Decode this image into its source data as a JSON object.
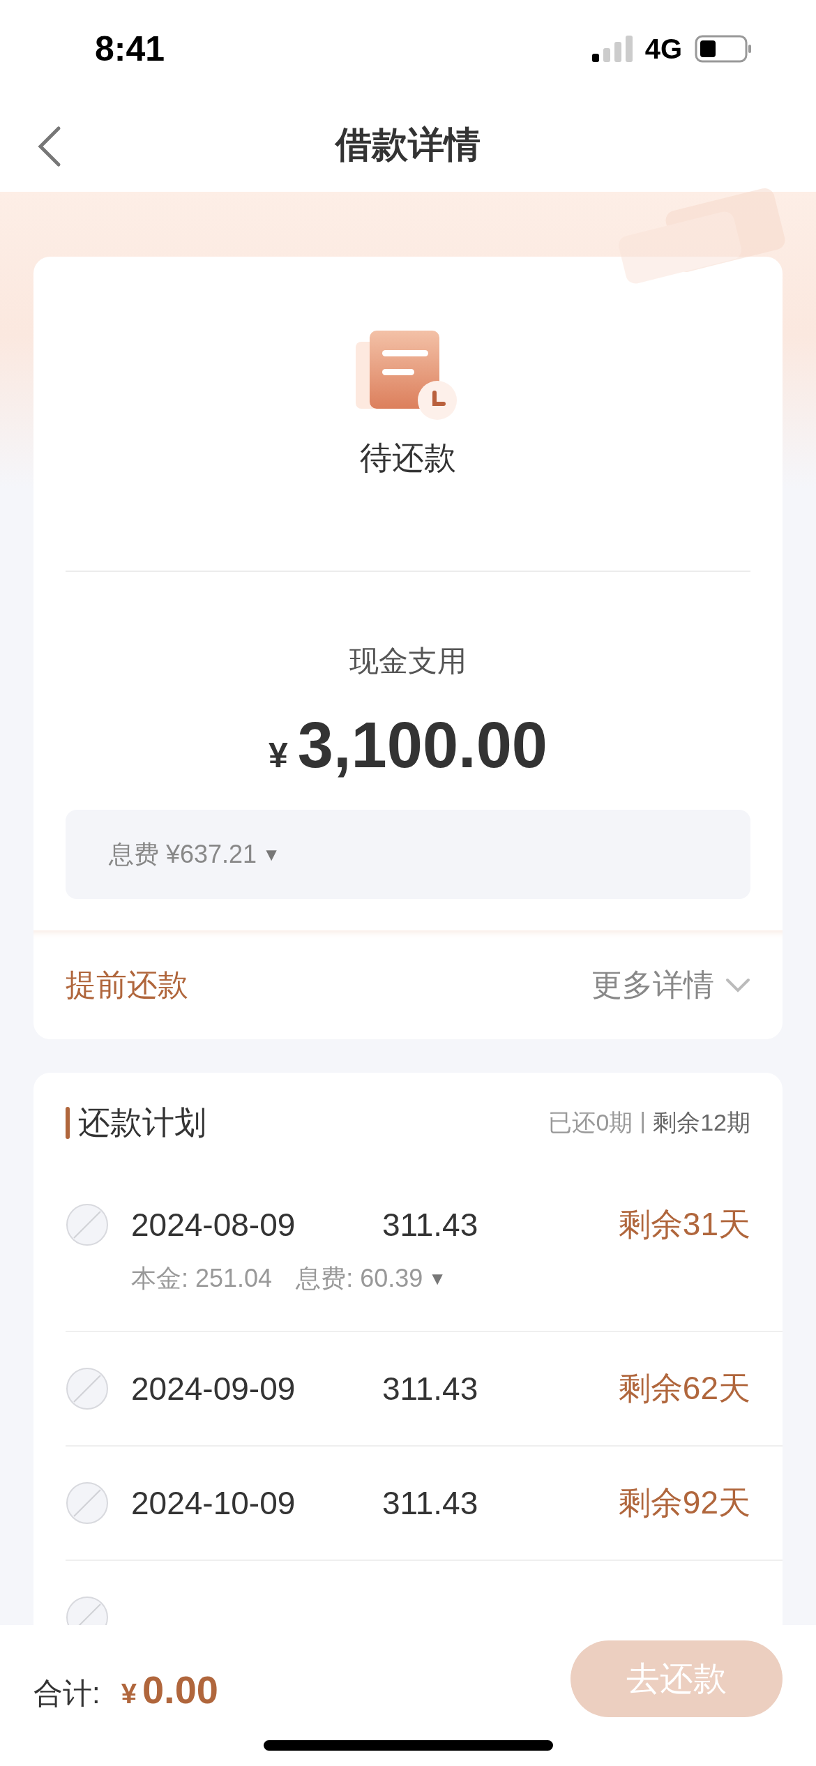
{
  "status_bar": {
    "time": "8:41",
    "network": "4G"
  },
  "nav": {
    "title": "借款详情"
  },
  "summary": {
    "status": "待还款",
    "label": "现金支用",
    "currency": "¥",
    "amount": "3,100.00",
    "fee": "息费 ¥637.21",
    "fee_toggle": "▼"
  },
  "actions": {
    "prepay": "提前还款",
    "more": "更多详情"
  },
  "plan": {
    "title": "还款计划",
    "paid": "已还0期",
    "separator": "|",
    "remaining": "剩余12期",
    "rows": [
      {
        "kind": "full",
        "date": "2024-08-09",
        "amount": "311.43",
        "remaining": "剩余31天",
        "principal": "本金: 251.04",
        "fee": "息费: 60.39",
        "toggle": "▼"
      },
      {
        "kind": "full",
        "date": "2024-09-09",
        "amount": "311.43",
        "remaining": "剩余62天"
      },
      {
        "kind": "full",
        "date": "2024-10-09",
        "amount": "311.43",
        "remaining": "剩余92天"
      },
      {
        "kind": "cut"
      }
    ]
  },
  "footer": {
    "total_label": "合计:",
    "currency": "¥",
    "total": "0.00",
    "pay_button": "去还款"
  }
}
